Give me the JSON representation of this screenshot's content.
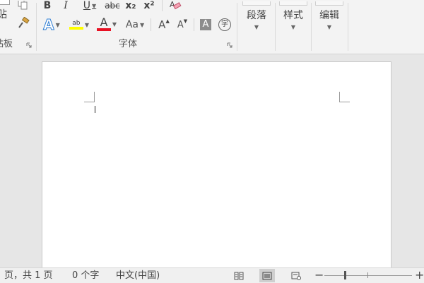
{
  "ribbon": {
    "clipboard": {
      "label": "粘板",
      "paste_label": "贴"
    },
    "font": {
      "label": "字体",
      "bold": "B",
      "italic": "I",
      "underline": "U",
      "strike": "abc",
      "subscript": "x₂",
      "superscript": "x²",
      "text_effect": "A",
      "highlight": "ab",
      "font_color": "A",
      "change_case": "Aa",
      "grow": "A",
      "shrink": "A",
      "shade": "A",
      "phonetic": "字"
    },
    "paragraph": {
      "label": "段落"
    },
    "styles": {
      "label": "样式"
    },
    "editing": {
      "label": "编辑"
    }
  },
  "colors": {
    "highlight": "#ffff00",
    "font_color": "#e81123",
    "text_effect": "#2b7cd3"
  },
  "status": {
    "page_info": "页，共 1 页",
    "word_count": "0 个字",
    "language": "中文(中国)"
  },
  "zoom": {
    "minus": "−",
    "plus": "+"
  }
}
